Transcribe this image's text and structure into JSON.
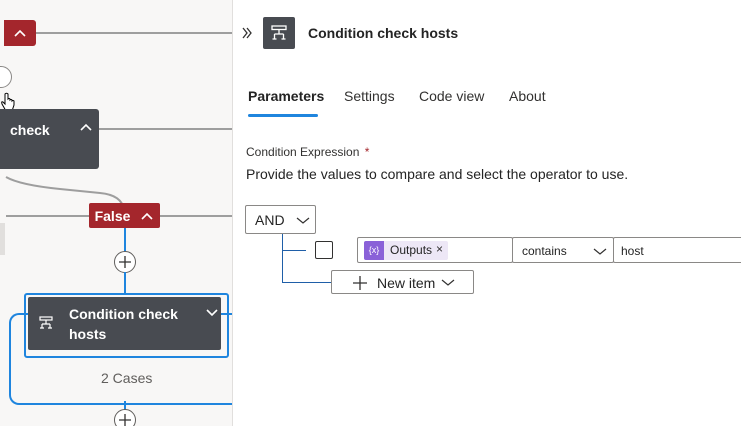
{
  "canvas": {
    "top_node": {
      "collapse_icon": "chevron-up-icon"
    },
    "check_card": {
      "label": "check"
    },
    "false_branch": {
      "label": "False"
    },
    "condition_node": {
      "title_line1": "Condition check",
      "title_line2": "hosts",
      "icon": "condition-icon"
    },
    "cases_label": "2 Cases"
  },
  "panel": {
    "title": "Condition check hosts",
    "tabs": [
      {
        "label": "Parameters"
      },
      {
        "label": "Settings"
      },
      {
        "label": "Code view"
      },
      {
        "label": "About"
      }
    ],
    "active_tab": "Parameters",
    "condition_label": "Condition Expression",
    "required_mark": "*",
    "description": "Provide the values to compare and select the operator to use.",
    "group_operator": "AND",
    "row": {
      "token_label": "Outputs",
      "token_remove": "×",
      "token_icon_text": "{x}",
      "operator": "contains",
      "value": "host"
    },
    "new_item_label": "New item"
  },
  "colors": {
    "accent": "#1f85de",
    "false_red": "#a4262c",
    "card_dark": "#484b51",
    "token_purple": "#8a61d8"
  }
}
